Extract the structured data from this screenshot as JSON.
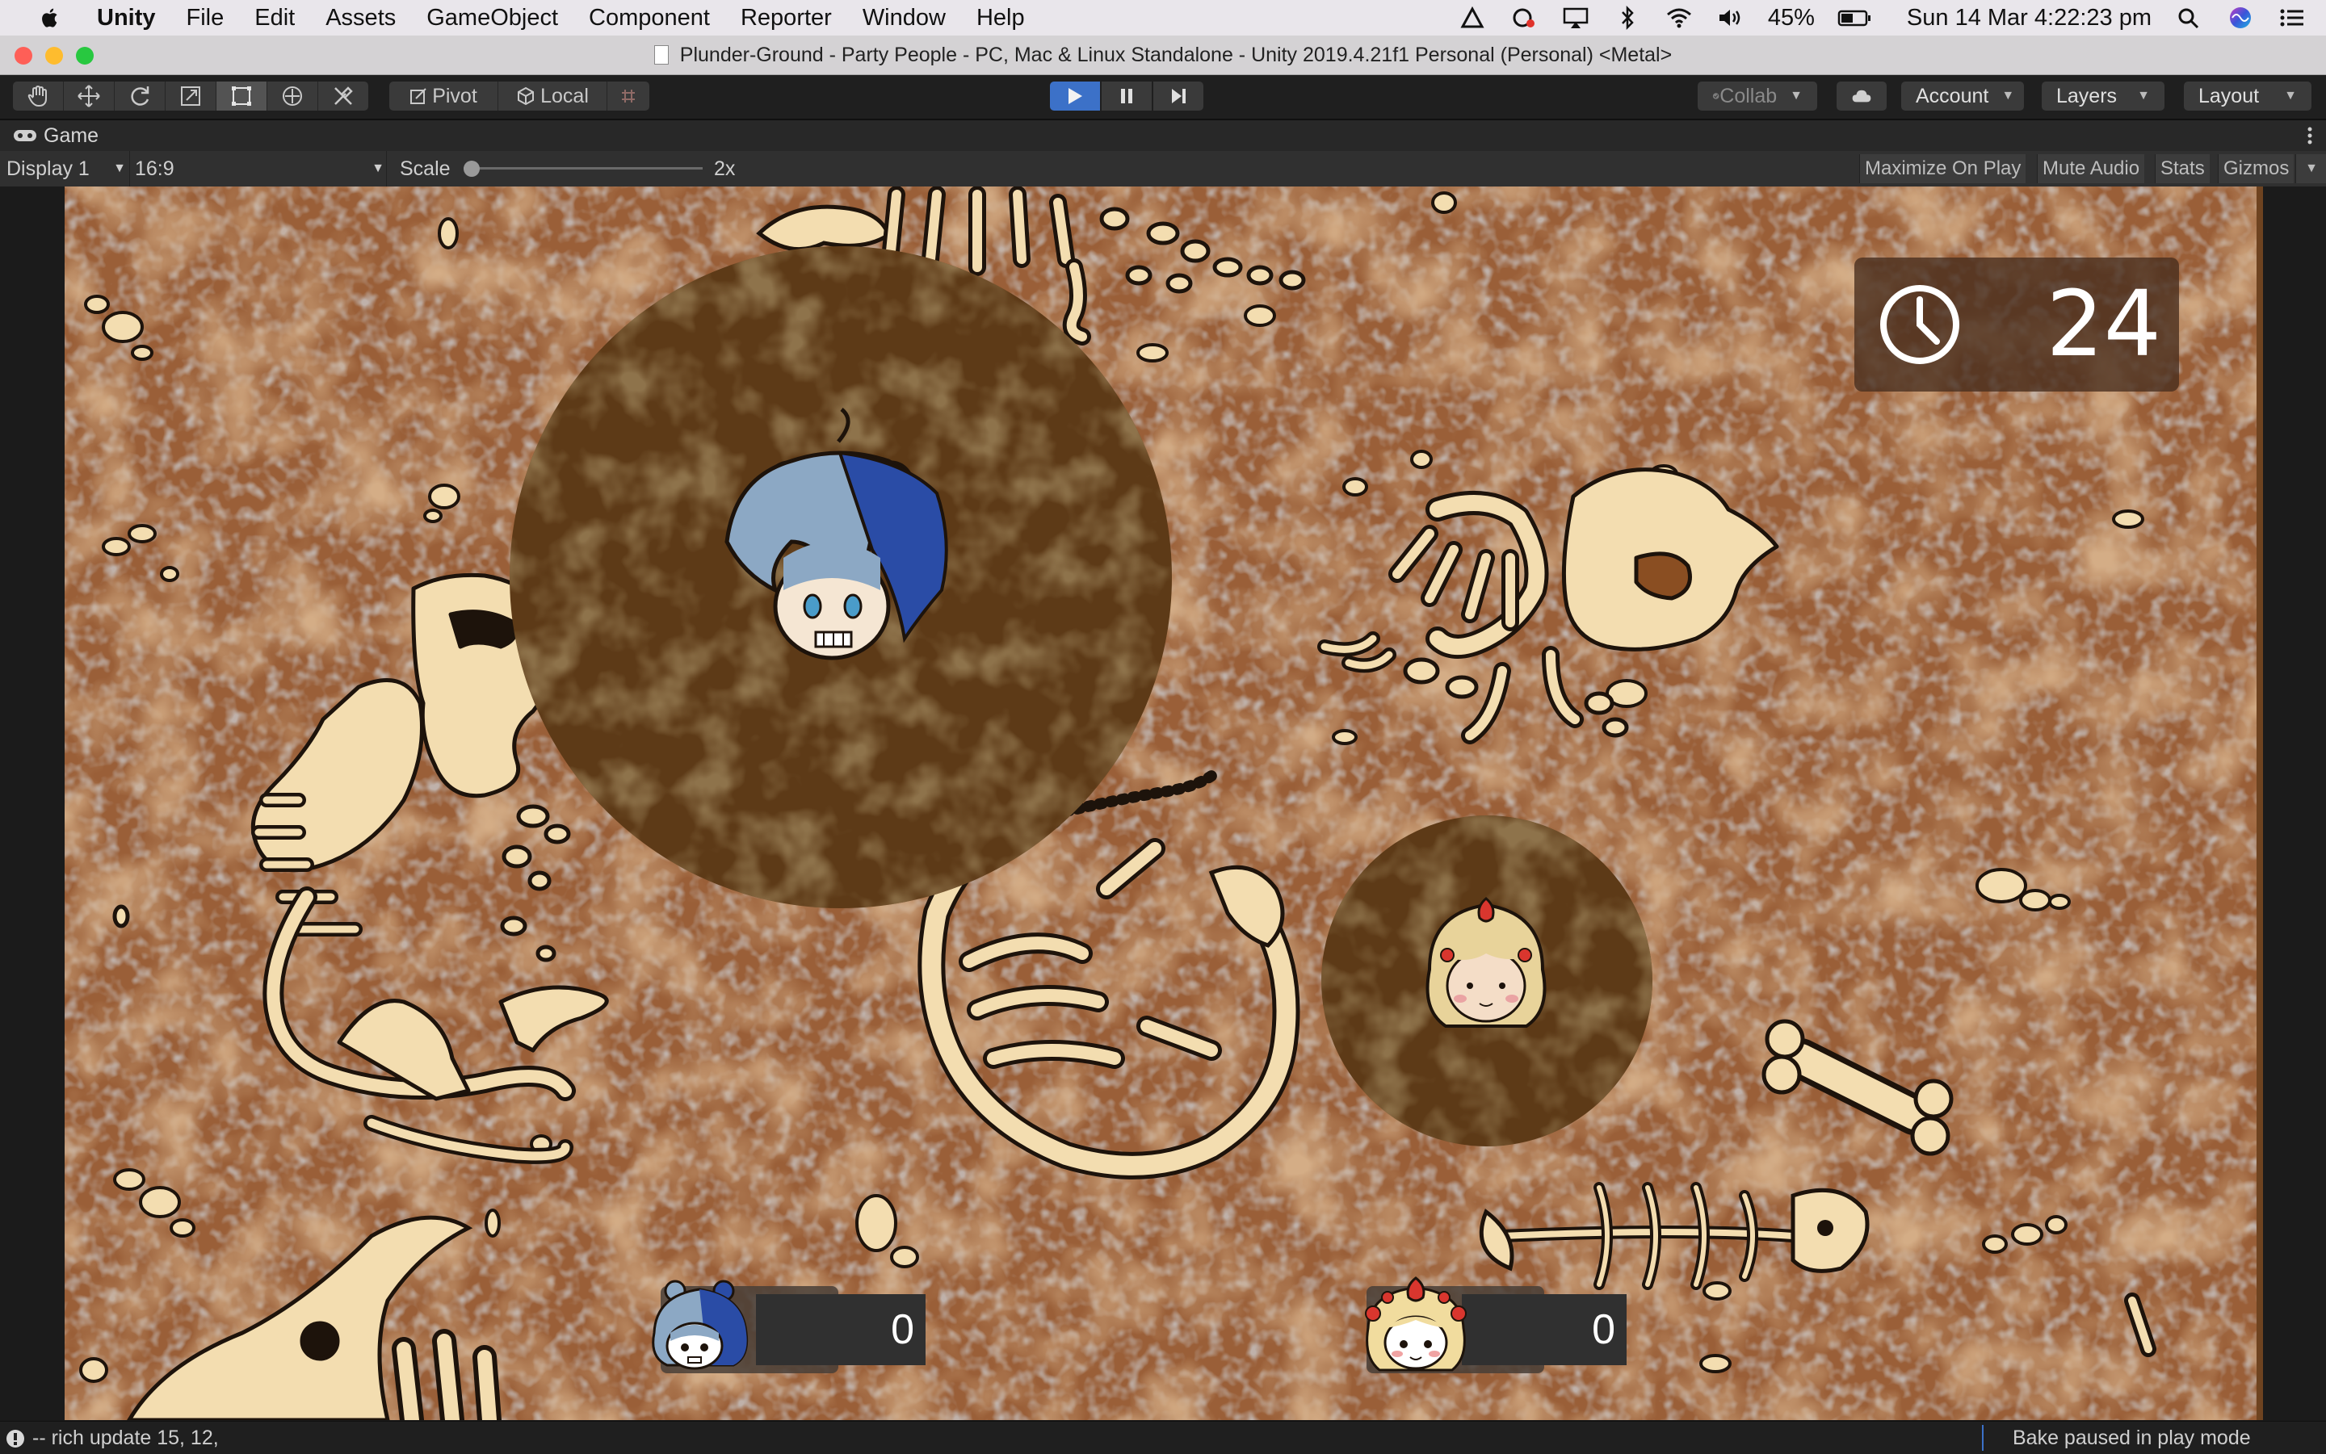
{
  "menubar": {
    "app_name": "Unity",
    "items": [
      "File",
      "Edit",
      "Assets",
      "GameObject",
      "Component",
      "Reporter",
      "Window",
      "Help"
    ],
    "battery": "45%",
    "datetime": "Sun 14 Mar  4:22:23 pm"
  },
  "window": {
    "title": "Plunder-Ground - Party People - PC, Mac & Linux Standalone - Unity 2019.4.21f1 Personal (Personal) <Metal>"
  },
  "toolbar": {
    "pivot_label": "Pivot",
    "local_label": "Local",
    "collab_label": "Collab",
    "account_label": "Account",
    "layers_label": "Layers",
    "layout_label": "Layout"
  },
  "game_tab": {
    "label": "Game"
  },
  "game_toolbar": {
    "display": "Display 1",
    "aspect": "16:9",
    "scale_label": "Scale",
    "scale_value": "2x",
    "maximize_label": "Maximize On Play",
    "mute_label": "Mute Audio",
    "stats_label": "Stats",
    "gizmos_label": "Gizmos"
  },
  "hud": {
    "timer": "24",
    "player1_score": "0",
    "player2_score": "0"
  },
  "statusbar": {
    "console_message": "-- rich update 15, 12,",
    "bake_status": "Bake paused in play mode"
  },
  "colors": {
    "dirt": "#9a5f38",
    "dug_hole": "#5d3a17",
    "bone": "#f3ddb0",
    "play_active": "#3c71c8"
  }
}
